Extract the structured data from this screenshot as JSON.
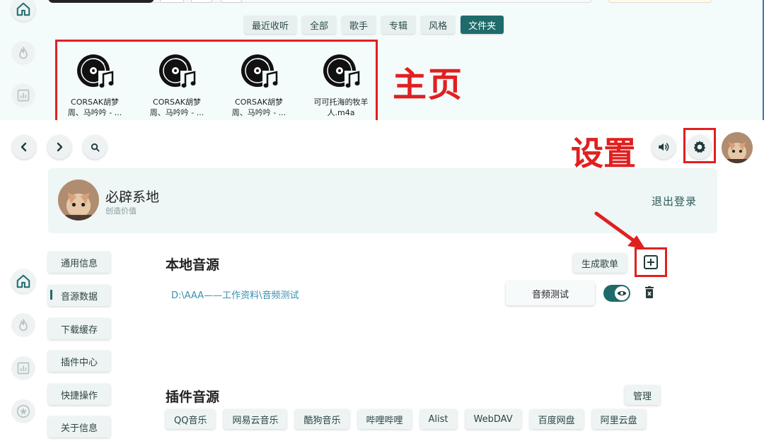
{
  "colors": {
    "accent": "#1f6b6b",
    "annotation": "#e02020",
    "link": "#3a8fb0",
    "panel_bg": "#eef6f6"
  },
  "home": {
    "filters": [
      {
        "label": "最近收听",
        "active": false
      },
      {
        "label": "全部",
        "active": false
      },
      {
        "label": "歌手",
        "active": false
      },
      {
        "label": "专辑",
        "active": false
      },
      {
        "label": "风格",
        "active": false
      },
      {
        "label": "文件夹",
        "active": true
      }
    ],
    "albums": [
      {
        "name_line1": "CORSAK胡梦",
        "name_line2": "周、马吟吟 - ..."
      },
      {
        "name_line1": "CORSAK胡梦",
        "name_line2": "周、马吟吟 - ..."
      },
      {
        "name_line1": "CORSAK胡梦",
        "name_line2": "周、马吟吟 - ..."
      },
      {
        "name_line1": "可可托海的牧羊",
        "name_line2": "人.m4a"
      }
    ],
    "annotation_label": "主页"
  },
  "settings": {
    "annotation_label": "设置",
    "profile": {
      "username": "必辟系地",
      "subtitle": "创造价值",
      "logout": "退出登录"
    },
    "sidebar": [
      {
        "label": "通用信息"
      },
      {
        "label": "音源数据"
      },
      {
        "label": "下载缓存"
      },
      {
        "label": "插件中心"
      },
      {
        "label": "快捷操作"
      },
      {
        "label": "关于信息"
      }
    ],
    "local_source": {
      "title": "本地音源",
      "generate_button": "生成歌单",
      "path": "D:\\AAA——工作资料\\音频测试",
      "test_button": "音频测试",
      "enabled": true
    },
    "plugin_source": {
      "title": "插件音源",
      "manage_button": "管理",
      "plugins": [
        "QQ音乐",
        "网易云音乐",
        "酷狗音乐",
        "哔哩哔哩",
        "Alist",
        "WebDAV",
        "百度网盘",
        "阿里云盘"
      ]
    }
  },
  "icons": [
    "home-icon",
    "fire-icon",
    "chart-icon",
    "star-icon",
    "back-icon",
    "forward-icon",
    "search-icon",
    "volume-icon",
    "gear-icon",
    "plus-icon",
    "eye-icon",
    "trash-icon",
    "disc-icon",
    "avatar"
  ]
}
